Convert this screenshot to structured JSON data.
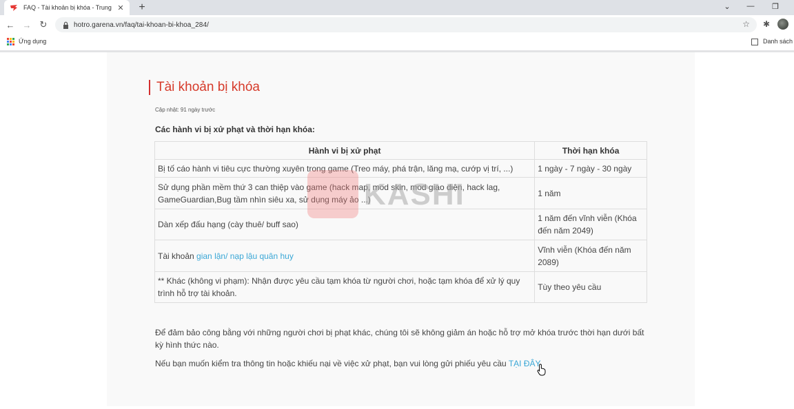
{
  "browser": {
    "tab_title": "FAQ - Tài khoản bị khóa - Trung",
    "url": "hotro.garena.vn/faq/tai-khoan-bi-khoa_284/",
    "bookmarks_apps_label": "Ứng dụng",
    "reading_list_label": "Danh sách"
  },
  "article": {
    "title": "Tài khoản bị khóa",
    "updated": "Cập nhật: 91 ngày trước",
    "section_heading": "Các hành vi bị xử phạt và thời hạn khóa:",
    "table": {
      "headers": [
        "Hành vi bị xử phạt",
        "Thời hạn khóa"
      ],
      "rows": [
        {
          "behavior": "Bị tố cáo hành vi tiêu cực thường xuyên trong game (Treo máy, phá trận, lăng mạ, cướp vị trí, ...)",
          "duration": "1 ngày - 7 ngày - 30 ngày"
        },
        {
          "behavior": "Sử dụng phần mềm thứ 3 can thiệp vào game (hack map, mod skin, mod giao diện, hack lag, GameGuardian,Bug tầm nhìn siêu xa, sử dụng máy ảo ...)",
          "duration": "1 năm"
        },
        {
          "behavior": "Dàn xếp đấu hạng (cày thuê/ buff sao)",
          "duration": "1 năm đến vĩnh viễn (Khóa đến năm 2049)"
        },
        {
          "behavior_prefix": "Tài khoản ",
          "behavior_link": "gian lận/ nạp lậu quân huy",
          "duration": "Vĩnh viễn (Khóa đến năm 2089)"
        },
        {
          "behavior": "** Khác (không vi phạm): Nhận được yêu cầu tạm khóa từ người chơi, hoặc tạm khóa để xử lý quy trình hỗ trợ tài khoản.",
          "duration": "Tùy theo yêu cầu"
        }
      ]
    },
    "paragraph_1": "Để đảm bảo công bằng với những người chơi bị phạt khác, chúng tôi sẽ không giảm án hoặc hỗ trợ mở khóa trước thời hạn dưới bất kỳ hình thức nào.",
    "paragraph_2_prefix": "Nếu bạn muốn kiểm tra thông tin hoặc khiếu nại về việc xử phạt, bạn vui lòng gửi phiếu yêu cầu ",
    "paragraph_2_link": "TẠI ĐÂY",
    "paragraph_2_suffix": "."
  },
  "watermark_text": "KASHI",
  "colors": {
    "title": "#d63a2a",
    "link": "#3aa7d6",
    "card_bg": "#f9f9f9"
  }
}
